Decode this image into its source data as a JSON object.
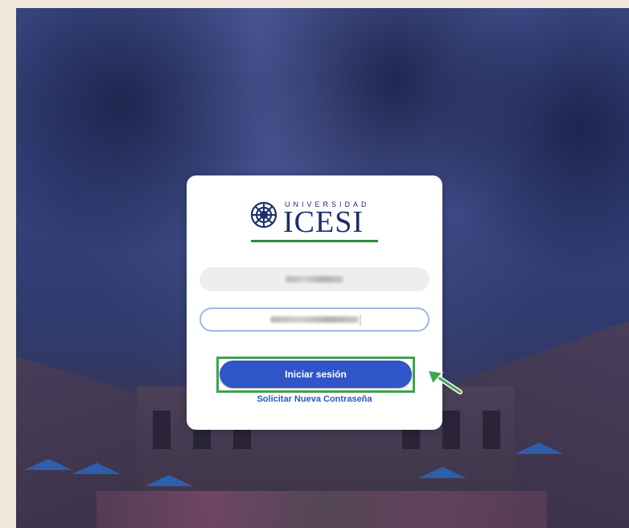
{
  "logo": {
    "top_text": "UNIVERSIDAD",
    "name": "ICESI",
    "colors": {
      "navy": "#1c2f6b",
      "green": "#2e8b3e"
    }
  },
  "login_form": {
    "username_value": "",
    "password_value": "",
    "submit_label": "Iniciar sesión",
    "forgot_link_label": "Solicitar Nueva Contraseña"
  },
  "annotation": {
    "highlight_color": "#3fa34d",
    "arrow_icon": "arrow-pointer-icon"
  },
  "colors": {
    "button": "#2f55c8",
    "link": "#2f55c8",
    "focus_border": "#9fb8e6"
  }
}
